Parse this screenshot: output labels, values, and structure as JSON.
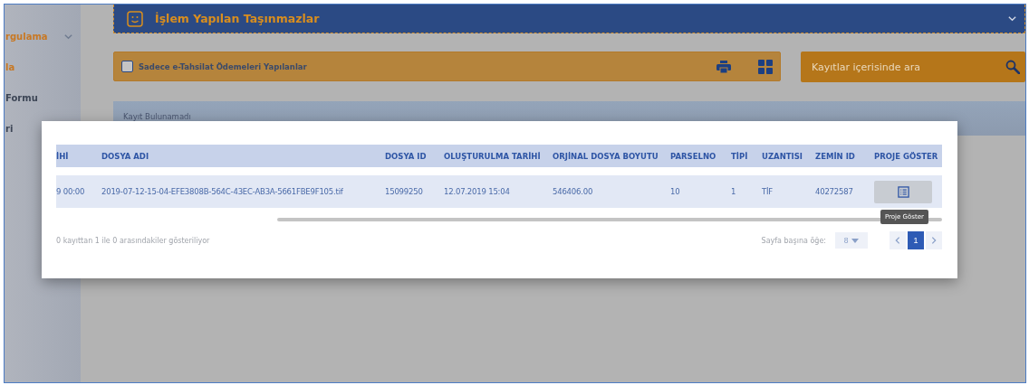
{
  "sidebar": {
    "items": [
      {
        "label": "rgulama",
        "active": true,
        "expanded": true
      },
      {
        "label": "la",
        "active": true
      },
      {
        "label": "Formu",
        "active": false
      },
      {
        "label": "ri",
        "active": false
      }
    ]
  },
  "panel": {
    "title": "İşlem Yapılan Taşınmazlar",
    "expanded": true
  },
  "filter": {
    "label": "Sadece e-Tahsilat Ödemeleri Yapılanlar",
    "checked": false
  },
  "search": {
    "placeholder": "Kayıtlar içerisinde ara"
  },
  "notice": "Kayıt Bulunamadı",
  "modal": {
    "table": {
      "columns": [
        "İHİ",
        "DOSYA ADI",
        "DOSYA ID",
        "OLUŞTURULMA TARİHİ",
        "ORJİNAL DOSYA BOYUTU",
        "PARSELNO",
        "TİPİ",
        "UZANTISI",
        "ZEMİN ID",
        "PROJE GÖSTER"
      ],
      "rows": [
        {
          "cells": [
            "9 00:00",
            "2019-07-12-15-04-EFE3808B-564C-43EC-AB3A-5661FBE9F105.tif",
            "15099250",
            "12.07.2019 15:04",
            "546406.00",
            "10",
            "1",
            "TİF",
            "40272587"
          ]
        }
      ]
    },
    "tooltip": "Proje Göster",
    "summary": "0 kayıttan 1 ile 0 arasındakiler gösteriliyor",
    "page_size_label": "Sayfa başına öğe:",
    "page_size": "8",
    "pages": [
      {
        "label": "1",
        "selected": true
      }
    ]
  }
}
